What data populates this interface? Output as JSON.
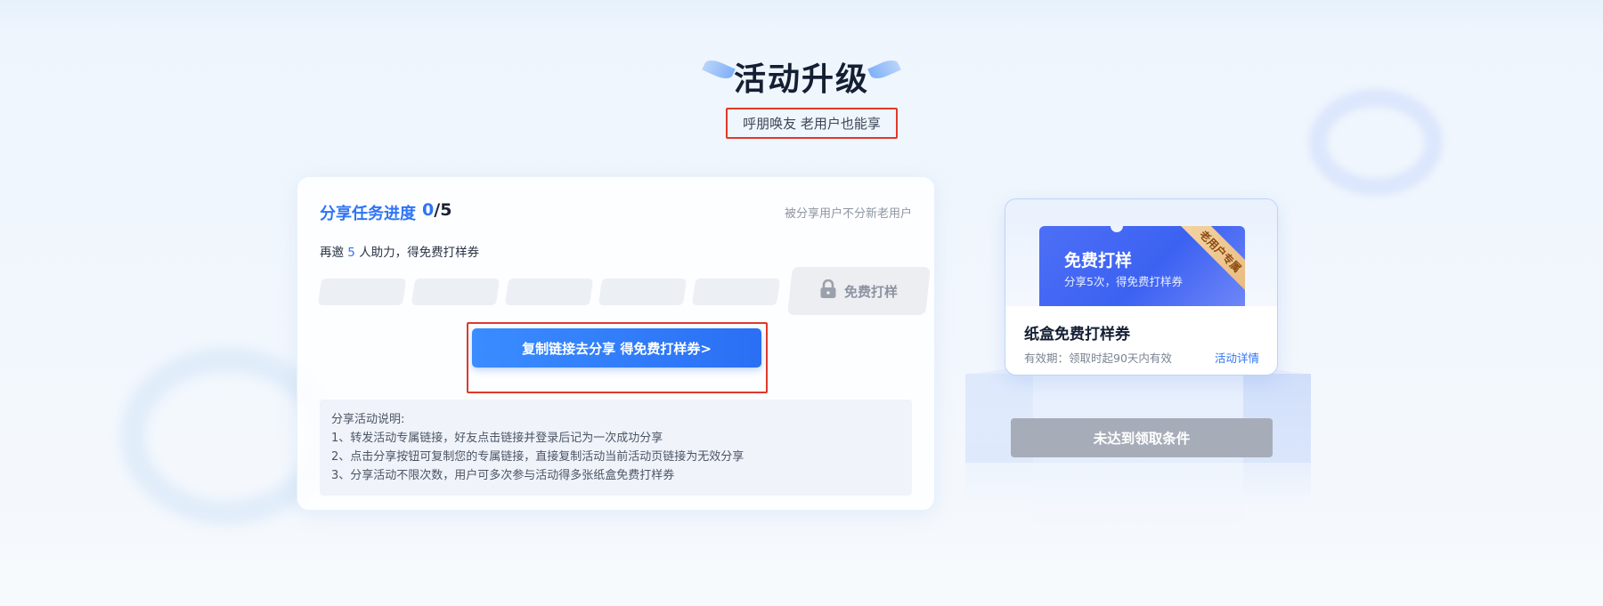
{
  "header": {
    "title": "活动升级",
    "subtitle": "呼朋唤友 老用户也能享"
  },
  "share_card": {
    "progress_title": "分享任务进度",
    "progress_current": "0",
    "progress_separator": "/",
    "progress_total": "5",
    "progress_note": "被分享用户不分新老用户",
    "invite_prefix": "再邀",
    "invite_count": "5",
    "invite_suffix": "人助力，得免费打样券",
    "progress_ratio": 0,
    "reward_lock_label": "免费打样",
    "share_button_label": "复制链接去分享 得免费打样券>",
    "notes_title": "分享活动说明:",
    "notes": [
      "1、转发活动专属链接，好友点击链接并登录后记为一次成功分享",
      "2、点击分享按钮可复制您的专属链接，直接复制活动当前活动页链接为无效分享",
      "3、分享活动不限次数，用户可多次参与活动得多张纸盒免费打样券"
    ]
  },
  "coupon": {
    "ticket_title": "免费打样",
    "ticket_subtitle": "分享5次，得免费打样券",
    "ribbon_label": "老用户专属",
    "name": "纸盒免费打样券",
    "validity": "有效期：领取时起90天内有效",
    "detail_link": "活动详情",
    "claim_button_label": "未达到领取条件"
  },
  "colors": {
    "accent": "#2f74f6",
    "highlight_border": "#e0392b",
    "disabled_button": "#a7adb8",
    "ribbon": "#e8b87a"
  },
  "icons": {
    "lock": "lock-icon"
  }
}
